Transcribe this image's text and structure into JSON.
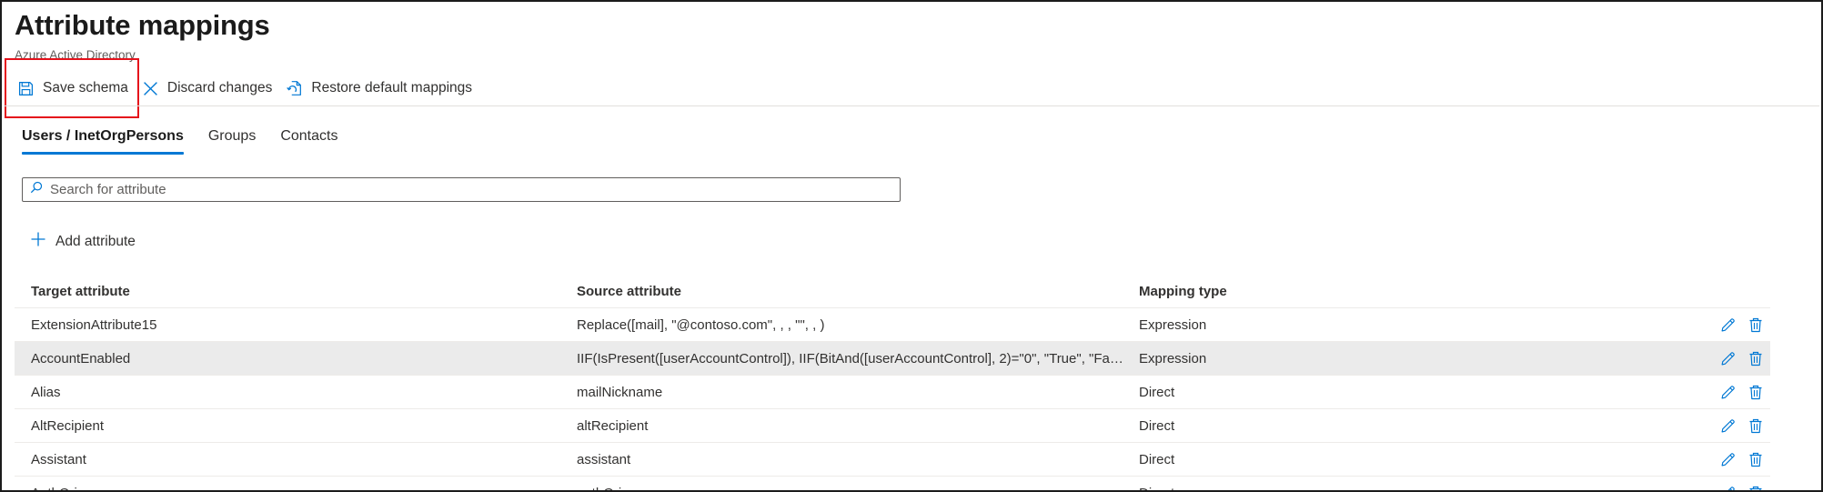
{
  "header": {
    "title": "Attribute mappings",
    "subtitle": "Azure Active Directory"
  },
  "toolbar": {
    "save_label": "Save schema",
    "save_icon": "save-icon",
    "discard_label": "Discard changes",
    "discard_icon": "close-icon",
    "restore_label": "Restore default mappings",
    "restore_icon": "restore-icon"
  },
  "tabs": [
    {
      "label": "Users / InetOrgPersons",
      "active": true
    },
    {
      "label": "Groups",
      "active": false
    },
    {
      "label": "Contacts",
      "active": false
    }
  ],
  "search": {
    "placeholder": "Search for attribute",
    "value": ""
  },
  "add_attribute": {
    "label": "Add attribute",
    "icon": "plus-icon"
  },
  "table": {
    "columns": [
      "Target attribute",
      "Source attribute",
      "Mapping type"
    ],
    "rows": [
      {
        "target": "ExtensionAttribute15",
        "source": "Replace([mail], \"@contoso.com\", , , \"\", , )",
        "type": "Expression"
      },
      {
        "target": "AccountEnabled",
        "source": "IIF(IsPresent([userAccountControl]), IIF(BitAnd([userAccountControl], 2)=\"0\", \"True\", \"Fals...",
        "type": "Expression"
      },
      {
        "target": "Alias",
        "source": "mailNickname",
        "type": "Direct"
      },
      {
        "target": "AltRecipient",
        "source": "altRecipient",
        "type": "Direct"
      },
      {
        "target": "Assistant",
        "source": "assistant",
        "type": "Direct"
      },
      {
        "target": "AuthOrig",
        "source": "authOrig",
        "type": "Direct"
      }
    ],
    "row_actions": [
      "edit-icon",
      "delete-icon"
    ]
  },
  "colors": {
    "accent": "#0078d4",
    "highlight": "#e5111b",
    "selected_row": "#ebebeb"
  }
}
